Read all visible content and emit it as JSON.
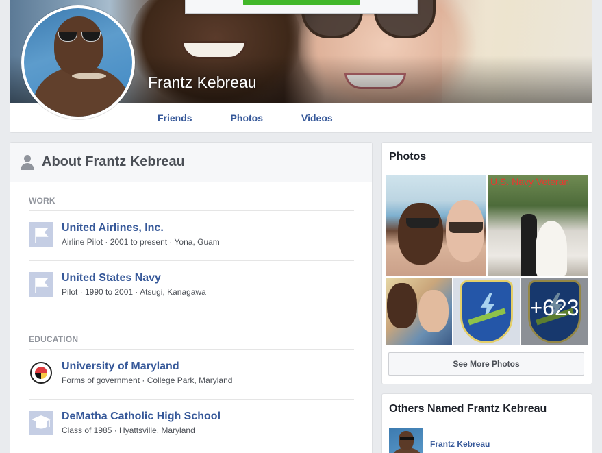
{
  "profile": {
    "name": "Frantz Kebreau"
  },
  "nav": {
    "tabs": [
      {
        "label": "Friends"
      },
      {
        "label": "Photos"
      },
      {
        "label": "Videos"
      }
    ]
  },
  "about": {
    "title": "About Frantz Kebreau",
    "work_label": "WORK",
    "work": [
      {
        "title": "United Airlines, Inc.",
        "sub": "Airline Pilot · 2001 to present · Yona, Guam",
        "icon": "flag-icon"
      },
      {
        "title": "United States Navy",
        "sub": "Pilot · 1990 to 2001 · Atsugi, Kanagawa",
        "icon": "flag-icon"
      }
    ],
    "education_label": "EDUCATION",
    "education": [
      {
        "title": "University of Maryland",
        "sub": "Forms of government · College Park, Maryland",
        "icon": "university-seal-icon"
      },
      {
        "title": "DeMatha Catholic High School",
        "sub": "Class of 1985 · Hyattsville, Maryland",
        "icon": "graduation-cap-icon"
      }
    ]
  },
  "photos": {
    "title": "Photos",
    "tile2_caption": "U.S. Navy Veteran",
    "more_count": "+623",
    "see_more_label": "See More Photos"
  },
  "others": {
    "title": "Others Named Frantz Kebreau",
    "items": [
      {
        "name": "Frantz Kebreau"
      }
    ]
  },
  "colors": {
    "link": "#365899",
    "background": "#e9ebee",
    "accent_green": "#42b72a",
    "icon_placeholder": "#c5cee4"
  }
}
